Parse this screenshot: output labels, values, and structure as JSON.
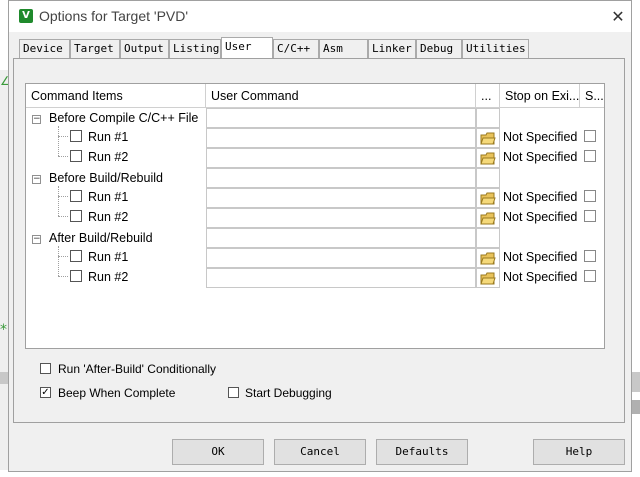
{
  "window": {
    "title": "Options for Target 'PVD'",
    "close_glyph": "✕",
    "icon_letter": "V"
  },
  "tabs": [
    {
      "label": "Device"
    },
    {
      "label": "Target"
    },
    {
      "label": "Output"
    },
    {
      "label": "Listing"
    },
    {
      "label": "User"
    },
    {
      "label": "C/C++"
    },
    {
      "label": "Asm"
    },
    {
      "label": "Linker"
    },
    {
      "label": "Debug"
    },
    {
      "label": "Utilities"
    }
  ],
  "active_tab": "User",
  "table": {
    "headers": {
      "items": "Command Items",
      "command": "User Command",
      "browse": "...",
      "stop": "Stop on Exi...",
      "s": "S..."
    },
    "groups": [
      {
        "label": "Before Compile C/C++ File",
        "rows": [
          {
            "label": "Run #1",
            "command": "",
            "stop": "Not Specified"
          },
          {
            "label": "Run #2",
            "command": "",
            "stop": "Not Specified"
          }
        ]
      },
      {
        "label": "Before Build/Rebuild",
        "rows": [
          {
            "label": "Run #1",
            "command": "",
            "stop": "Not Specified"
          },
          {
            "label": "Run #2",
            "command": "",
            "stop": "Not Specified"
          }
        ]
      },
      {
        "label": "After Build/Rebuild",
        "rows": [
          {
            "label": "Run #1",
            "command": "",
            "stop": "Not Specified"
          },
          {
            "label": "Run #2",
            "command": "",
            "stop": "Not Specified"
          }
        ]
      }
    ]
  },
  "options": {
    "run_after_build": {
      "label": "Run 'After-Build' Conditionally",
      "checked": false
    },
    "beep": {
      "label": "Beep When Complete",
      "checked": true
    },
    "start_debug": {
      "label": "Start Debugging",
      "checked": false
    }
  },
  "buttons": {
    "ok": "OK",
    "cancel": "Cancel",
    "defaults": "Defaults",
    "help": "Help"
  },
  "colors": {
    "accent_icon": "#1f8a2c",
    "folder": "#e8c25a"
  }
}
